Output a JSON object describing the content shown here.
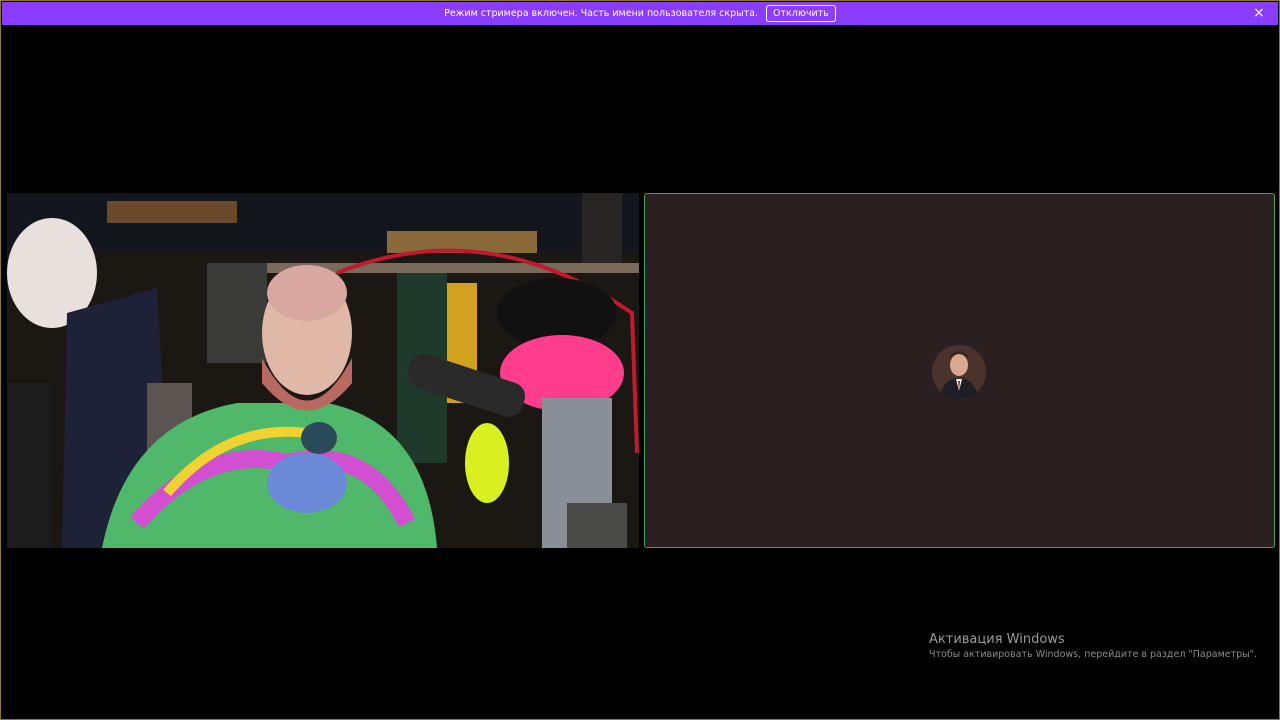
{
  "banner": {
    "text": "Режим стримера включен. Часть имени пользователя скрыта.",
    "button_label": "Отключить",
    "close_icon": "×",
    "color": "#8b3dff"
  },
  "stage": {
    "video_tile": {
      "content": "webcam-stream"
    },
    "voice_tile": {
      "border_color": "#3ba55c",
      "background": "#2a1f21",
      "speaking": true
    }
  },
  "watermark": {
    "title": "Активация Windows",
    "subtitle": "Чтобы активировать Windows, перейдите в раздел \"Параметры\"."
  }
}
